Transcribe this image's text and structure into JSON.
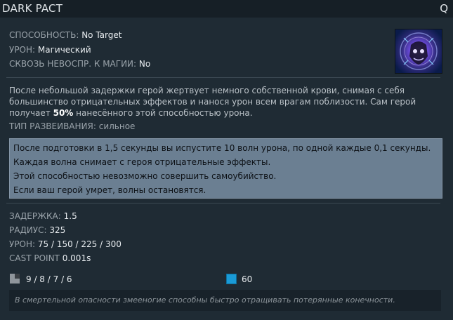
{
  "header": {
    "title": "DARK PACT",
    "hotkey": "Q"
  },
  "ability_info": [
    {
      "label": "СПОСОБНОСТЬ:",
      "value": "No Target"
    },
    {
      "label": "УРОН:",
      "value": "Магический"
    },
    {
      "label": "СКВОЗЬ НЕВОСПР. К МАГИИ:",
      "value": "No"
    }
  ],
  "icon": {
    "name": "dark-pact-icon"
  },
  "description": {
    "text_before": "После небольшой задержки герой жертвует немного собственной крови, снимая с себя большинство отрицательных эффектов и нанося урон всем врагам поблизости. Сам герой получает ",
    "highlight": "50%",
    "text_after": " нанесённого этой способностью урона."
  },
  "dispel": {
    "label": "ТИП РАЗВЕИВАНИЯ:",
    "value": "сильное"
  },
  "notes": [
    "После подготовки в 1,5 секунды вы испустите 10 волн урона, по одной каждые 0,1 секунды.",
    "Каждая волна снимает с героя отрицательные эффекты.",
    "Этой способностью невозможно совершить самоубийство.",
    "Если ваш герой умрет, волны остановятся."
  ],
  "stats": [
    {
      "label": "ЗАДЕРЖКА:",
      "value": "1.5"
    },
    {
      "label": "РАДИУС:",
      "value": "325"
    },
    {
      "label": "УРОН:",
      "value": "75 / 150 / 225 / 300"
    },
    {
      "label": "CAST POINT",
      "value": "0.001s"
    }
  ],
  "cooldown": {
    "icon": "cooldown-icon",
    "value": "9 / 8 / 7 / 6"
  },
  "mana": {
    "icon": "mana-icon",
    "value": "60",
    "color": "#1a9bd7"
  },
  "lore": "В смертельной опасности змееногие способны быстро отращивать потерянные конечности."
}
